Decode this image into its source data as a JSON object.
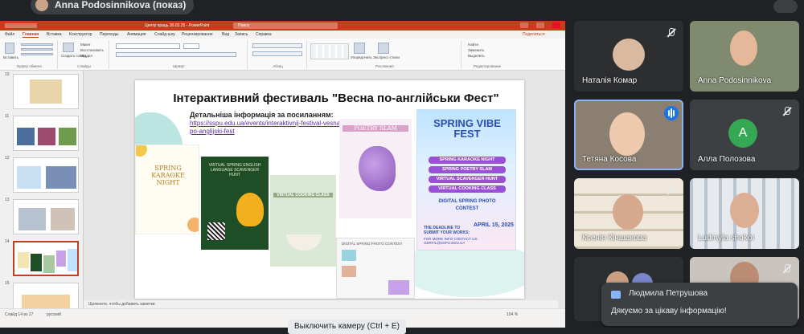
{
  "presenter": {
    "label": "Anna Podosinnikova (показ)"
  },
  "powerpoint": {
    "title": "Центр праць 30.03.25  -  PowerPoint",
    "search_placeholder": "Поиск",
    "share_label": "Поделиться",
    "tabs": [
      "Файл",
      "Главная",
      "Вставка",
      "Конструктор",
      "Переходы",
      "Анимация",
      "Слайд-шоу",
      "Рецензирование",
      "Вид",
      "Запись",
      "Справка"
    ],
    "active_tab": "Главная",
    "ribbon_groups": [
      "Буфер обмена",
      "Слайды",
      "Шрифт",
      "Абзац",
      "Рисование",
      "Редактирование"
    ],
    "ribbon_items": {
      "paste": "Вставить",
      "create_slide": "Создать слайд",
      "layout": "Макет",
      "reset": "Восстановить",
      "section": "Раздел",
      "arrange": "Упорядочить",
      "quick_styles": "Экспресс-стили",
      "find": "Найти",
      "replace": "Заменить",
      "select": "Выделить"
    },
    "thumbnail_numbers": [
      "10",
      "11",
      "12",
      "13",
      "14",
      "15"
    ],
    "selected_slide": "14",
    "notes_placeholder": "Щелкните, чтобы добавить заметки",
    "status_left": "Слайд 14 из 27",
    "status_lang": "русский",
    "status_zoom": "104 %"
  },
  "slide": {
    "title": "Інтерактивний фестиваль \"Весна по-англійськи Фест\"",
    "subtitle": "Детальніша інформація за посиланням:",
    "link": "https://sspu.edu.ua/events/interaktivnij-festival-vesna-po-anglijski-fest",
    "karaoke_title": "SPRING KARAOKE NIGHT",
    "scavenger_title": "VIRTUAL SPRING ENGLISH LANGUAGE SCAVENGER HUNT",
    "cooking_title": "VIRTUAL COOKING CLASS",
    "poetry_title": "POETRY SLAM",
    "contest_title": "DIGITAL SPRING PHOTO CONTEST",
    "vibe": {
      "title": "SPRING VIBE FEST",
      "items": [
        "SPRING KARAOKE NIGHT",
        "SPRING POETRY SLAM",
        "VIRTUAL SCAVENGER HUNT",
        "VIRTUAL COOKING CLASS"
      ],
      "photo": "DIGITAL SPRING PHOTO CONTEST",
      "deadline": "THE DEADLINE TO SUBMIT YOUR WORKS:",
      "date": "APRIL 15, 2025",
      "contact": "FOR MORE INFO CONTACT US: GERFIL@SSPU.EDU.UA"
    }
  },
  "participants": [
    {
      "name": "Наталія Комар"
    },
    {
      "name": "Anna Podosinnikova"
    },
    {
      "name": "Тетяна Косова"
    },
    {
      "name": "Алла Полозова",
      "initial": "A"
    },
    {
      "name": "Ксенія Кіншакова"
    },
    {
      "name": "Ludmyla shokot"
    }
  ],
  "chat_toast": {
    "sender": "Людмила Петрушова",
    "message": "Дякуємо за цікаву інформацію!"
  },
  "camera_tooltip": "Выключить камеру (Ctrl + E)",
  "colors": {
    "ppt_accent": "#c43e1c",
    "meet_bg": "#202124",
    "tile_bg": "#3c4043",
    "speaking": "#8ab4f8"
  }
}
